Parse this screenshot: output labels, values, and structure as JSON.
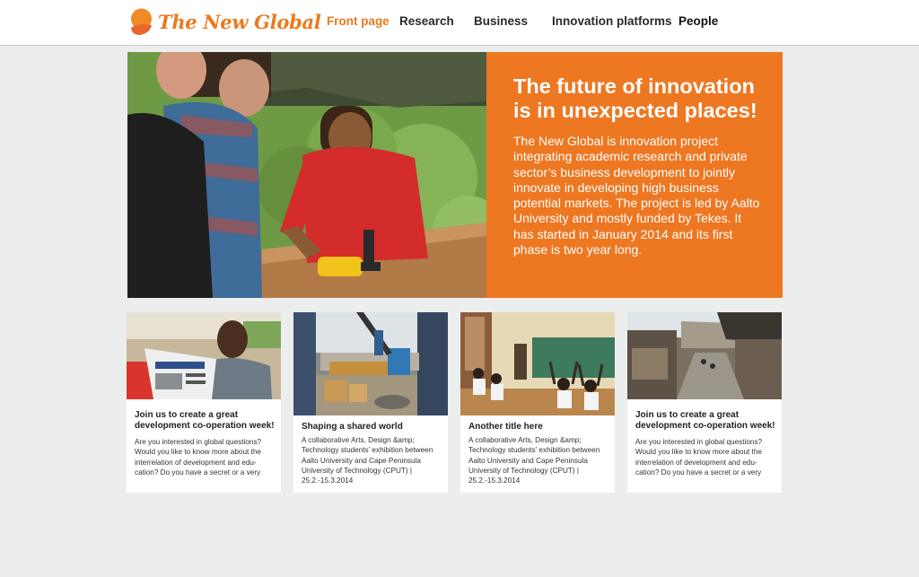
{
  "brand": {
    "name": "The New Global",
    "logo_icon": "orange-balloon-logo",
    "accent_color": "#ee7722"
  },
  "nav": {
    "items": [
      {
        "label": "Front page",
        "active": true
      },
      {
        "label": "Research"
      },
      {
        "label": "Business"
      },
      {
        "label": "Innovation platforms"
      },
      {
        "label": "People"
      }
    ]
  },
  "hero": {
    "title": "The future of innovation is in unexpected places!",
    "body": "The New Global is innovation project integrating academic research and private sector’s business development to jointly innovate in developing high business potential markets. The project is led by Aalto University and mostly funded by Tekes. It has started in January 2014 and its first phase is two year long.",
    "image": "men-working-with-power-drill-photo"
  },
  "cards": [
    {
      "title": "Join us to create a great development co-operation week!",
      "body": "Are you interested in global questions? Would you like to know more about the interrelation of development and edu-cation? Do you have a secret or a very",
      "image": "man-reading-newspaper-photo"
    },
    {
      "title": "Shaping a shared world",
      "body": "A collaborative Arts, Design &amp; Technology students’ exhibition between Aalto University and Cape Peninsula University of Technology (CPUT) | 25.2.-15.3.2014",
      "image": "truck-loading-yard-photo"
    },
    {
      "title": "Another title here",
      "body": "A collaborative Arts, Design &amp; Technology students’ exhibition between Aalto University and Cape Peninsula University of Technology (CPUT) | 25.2.-15.3.2014",
      "image": "classroom-children-photo"
    },
    {
      "title": "Join us to create a great development co-operation week!",
      "body": "Are you interested in global questions? Would you like to know more about the interrelation of development and edu-cation? Do you have a secret or a very",
      "image": "market-street-photo"
    }
  ]
}
